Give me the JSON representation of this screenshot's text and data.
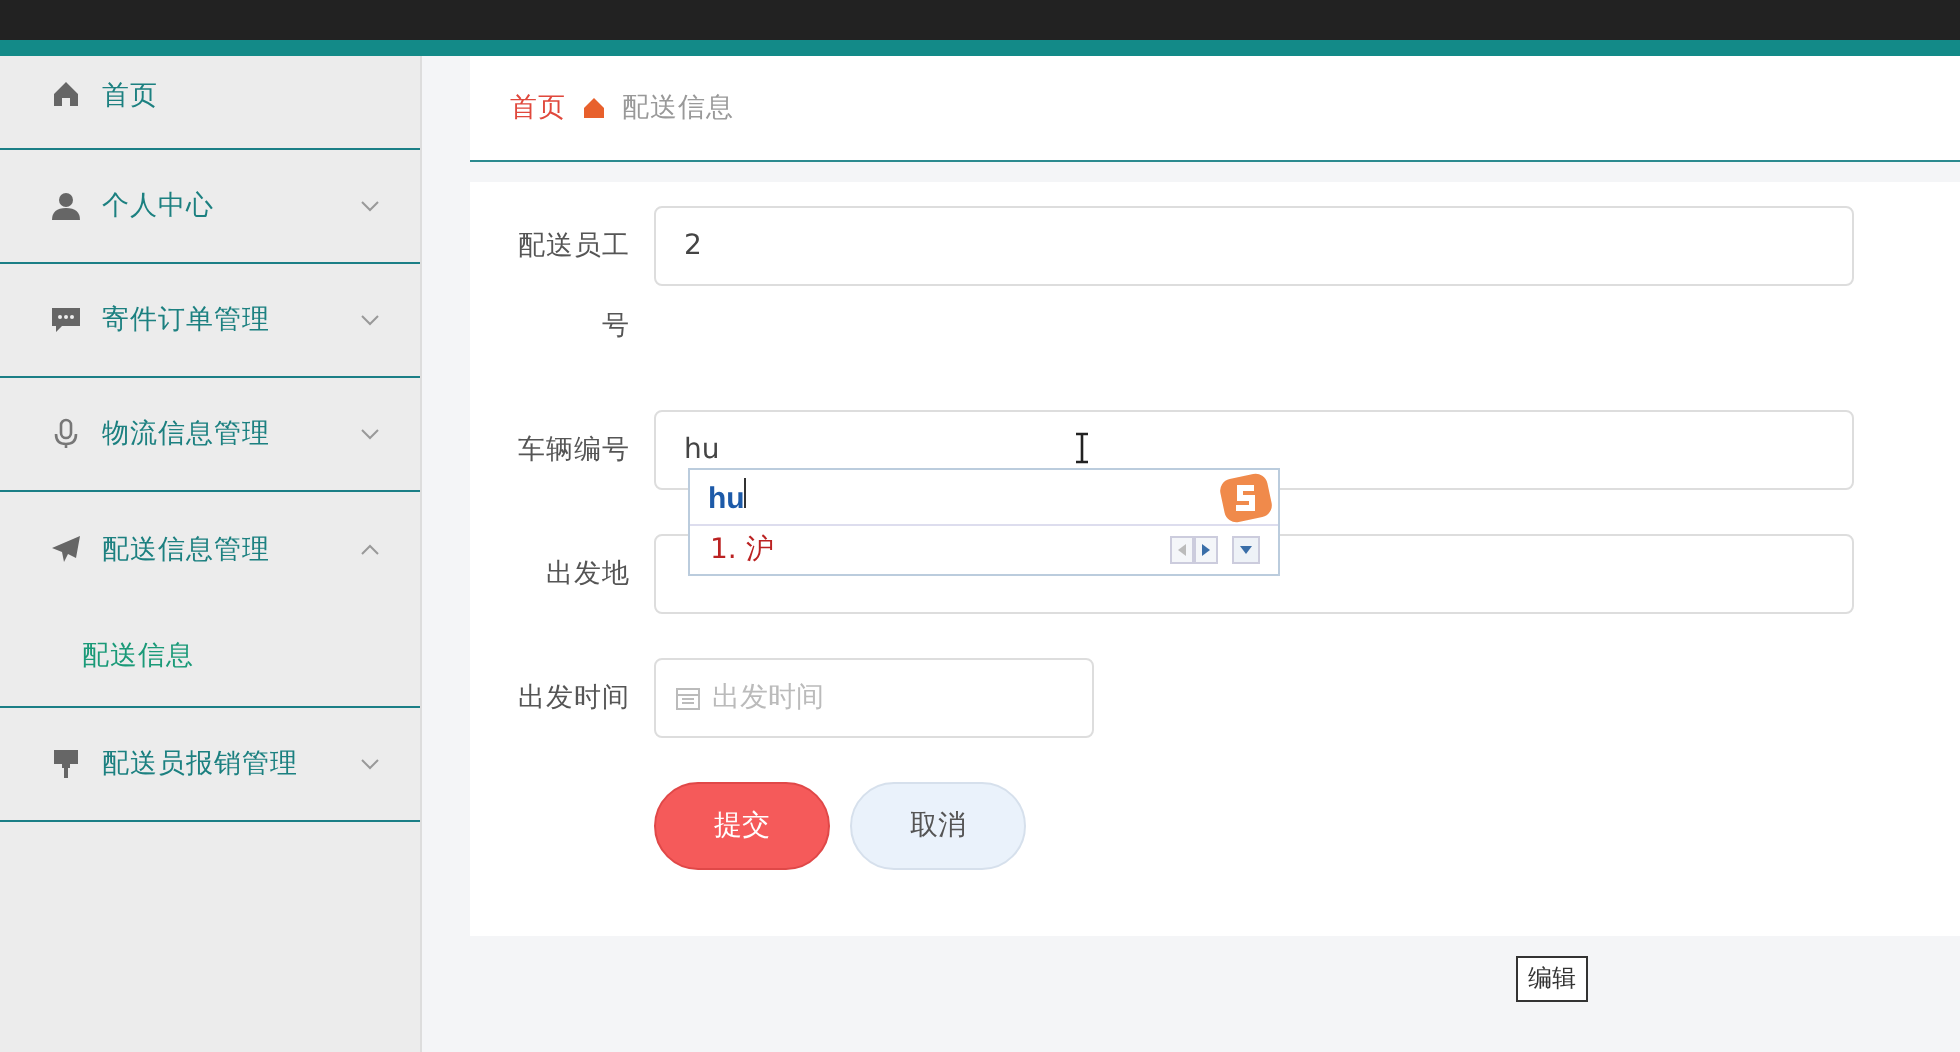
{
  "sidebar": {
    "items": [
      {
        "label": "首页"
      },
      {
        "label": "个人中心",
        "expanded": false
      },
      {
        "label": "寄件订单管理",
        "expanded": false
      },
      {
        "label": "物流信息管理",
        "expanded": false
      },
      {
        "label": "配送信息管理",
        "expanded": true,
        "children": [
          {
            "label": "配送信息",
            "selected": true
          }
        ]
      },
      {
        "label": "配送员报销管理",
        "expanded": false
      }
    ]
  },
  "breadcrumb": {
    "home": "首页",
    "current": "配送信息"
  },
  "form": {
    "fields": [
      {
        "label": "配送员工号",
        "kind": "text",
        "value": "2"
      },
      {
        "label": "车辆编号",
        "kind": "text",
        "value": "hu",
        "ime": {
          "composition": "hu",
          "candidate": "1. 沪"
        }
      },
      {
        "label": "出发地",
        "kind": "text"
      },
      {
        "label": "出发时间",
        "kind": "date",
        "placeholder": "出发时间"
      }
    ],
    "buttons": [
      {
        "label": "提交",
        "kind": "primary"
      },
      {
        "label": "取消",
        "kind": "secondary"
      }
    ]
  },
  "tooltip": "编辑"
}
